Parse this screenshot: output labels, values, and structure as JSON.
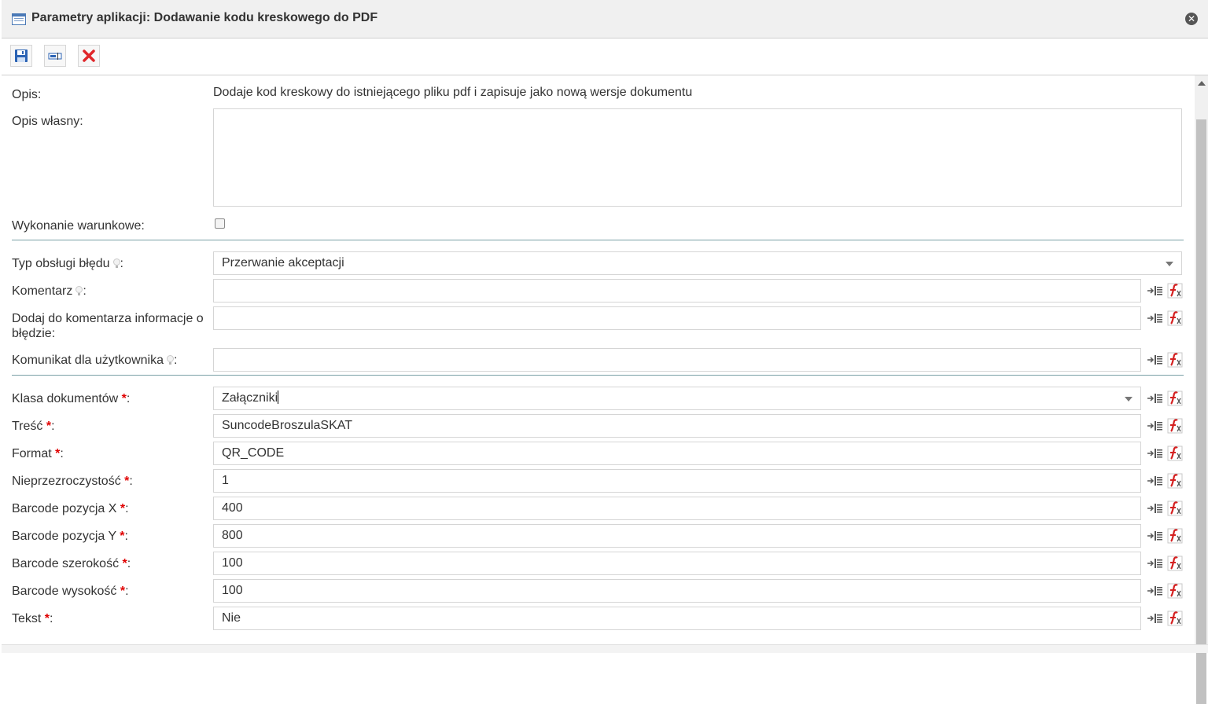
{
  "window": {
    "title": "Parametry aplikacji: Dodawanie kodu kreskowego do PDF"
  },
  "toolbar": {
    "buttons": [
      {
        "name": "save",
        "icon": "save-disk-icon"
      },
      {
        "name": "rename",
        "icon": "text-field-icon"
      },
      {
        "name": "delete",
        "icon": "red-x-icon"
      }
    ]
  },
  "form": {
    "opis_label": "Opis:",
    "opis_value": "Dodaje kod kreskowy do istniejącego pliku pdf i zapisuje jako nową wersje dokumentu",
    "opis_wlasny_label": "Opis własny:",
    "opis_wlasny_value": "",
    "wykonanie_label": "Wykonanie warunkowe:",
    "wykonanie_checked": false,
    "typ_obslugi_label": "Typ obsługi błędu",
    "typ_obslugi_value": "Przerwanie akceptacji",
    "komentarz_label": "Komentarz",
    "komentarz_value": "",
    "dodaj_label_line1": "Dodaj do komentarza informacje o",
    "dodaj_label_line2": "błędzie:",
    "dodaj_value": "",
    "komunikat_label": "Komunikat dla użytkownika",
    "komunikat_value": "",
    "klasa_label": "Klasa dokumentów",
    "klasa_value": "Załączniki",
    "tresc_label": "Treść",
    "tresc_value": "SuncodeBroszulaSKAT",
    "format_label": "Format",
    "format_value": "QR_CODE",
    "nieprzezroczystosc_label": "Nieprzezroczystość",
    "nieprzezroczystosc_value": "1",
    "pozycja_x_label": "Barcode pozycja X",
    "pozycja_x_value": "400",
    "pozycja_y_label": "Barcode pozycja Y",
    "pozycja_y_value": "800",
    "szerokosc_label": "Barcode szerokość",
    "szerokosc_value": "100",
    "wysokosc_label": "Barcode wysokość",
    "wysokosc_value": "100",
    "tekst_label": "Tekst",
    "tekst_value": "Nie",
    "required_mark": "*",
    "colon": ":"
  },
  "colors": {
    "required": "#e00000",
    "separator": "#7aa0a6",
    "title_bar": "#f0f0f0"
  }
}
